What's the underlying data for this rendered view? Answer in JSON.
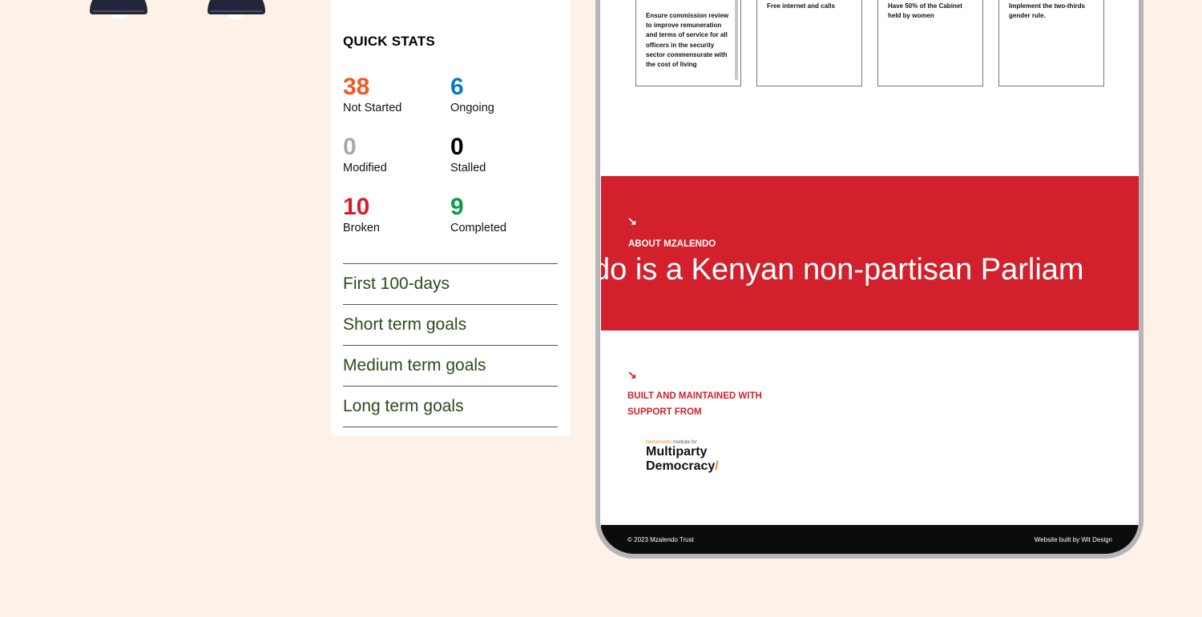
{
  "decor": {
    "lamps": [
      {
        "icon": "hanging-lamp-icon"
      },
      {
        "icon": "hanging-lamp-icon"
      }
    ]
  },
  "quick_stats": {
    "title": "QUICK STATS",
    "items": [
      {
        "value": "38",
        "label": "Not Started",
        "color": "#f05a24"
      },
      {
        "value": "6",
        "label": "Ongoing",
        "color": "#0a78c2"
      },
      {
        "value": "0",
        "label": "Modified",
        "color": "#a7a9ac"
      },
      {
        "value": "0",
        "label": "Stalled",
        "color": "#000000"
      },
      {
        "value": "10",
        "label": "Broken",
        "color": "#d2212c"
      },
      {
        "value": "9",
        "label": "Completed",
        "color": "#0c9a4a"
      }
    ],
    "goal_links": [
      {
        "label": "First 100-days"
      },
      {
        "label": "Short term goals"
      },
      {
        "label": "Medium term goals"
      },
      {
        "label": "Long term goals"
      }
    ]
  },
  "device_preview": {
    "promise_cards": [
      {
        "text": "Ensure commission review to improve remuneration and terms of service for all officers in the security sector commensurate with the cost of living"
      },
      {
        "text": "Free internet and calls"
      },
      {
        "text": "Have 50% of the Cabinet held by women"
      },
      {
        "text": "Implement the two-thirds gender rule."
      }
    ],
    "about": {
      "arrow_icon": "↘",
      "eyebrow": "ABOUT MZALENDO",
      "headline": "do is a Kenyan non-partisan Parliam"
    },
    "support": {
      "arrow_icon": "↘",
      "heading": "BUILT AND MAINTAINED WITH SUPPORT FROM",
      "partner": {
        "tag_highlight": "Netherlands",
        "tag_rest": " Institute for",
        "line1": "Multiparty",
        "line2": "Democracy"
      }
    },
    "footer": {
      "copyright": "© 2023 Mzalendo Trust",
      "credit": "Website built by Wit Design"
    }
  },
  "colors": {
    "page_bg": "#fef1e8",
    "brand_red": "#d2212c",
    "goal_text": "#2d4a1e",
    "footer_bg": "#0b0c0c"
  }
}
